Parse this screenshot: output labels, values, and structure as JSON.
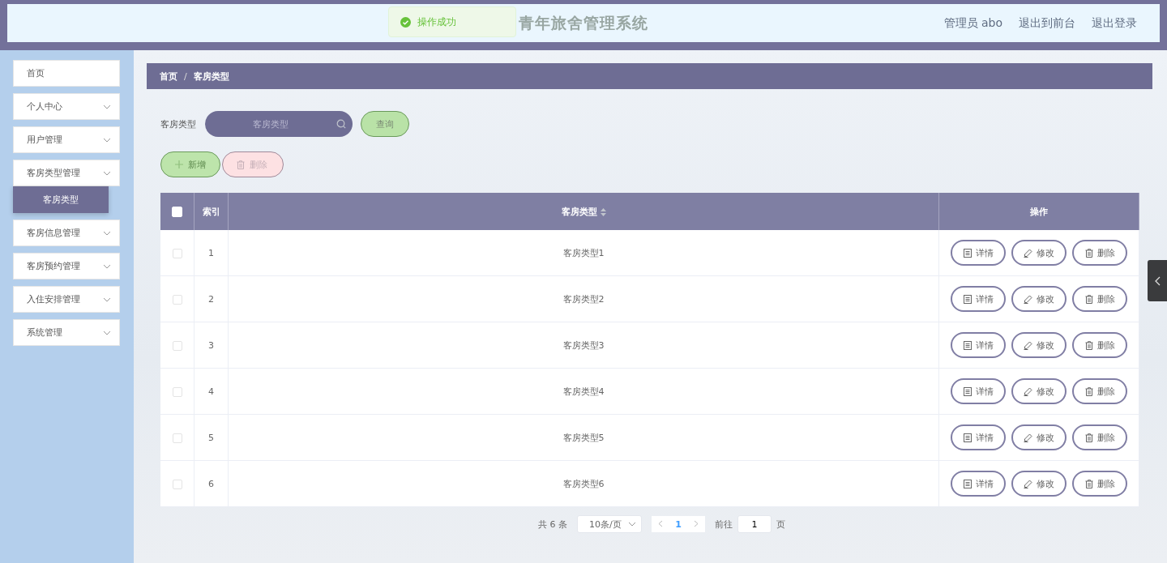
{
  "header": {
    "title": "青年旅舍管理系统",
    "toast": {
      "text": "操作成功",
      "kind": "success"
    },
    "links": [
      "管理员 abo",
      "退出到前台",
      "退出登录"
    ]
  },
  "sidebar": {
    "items": [
      {
        "label": "首页",
        "kind": "link"
      },
      {
        "label": "个人中心",
        "kind": "menu"
      },
      {
        "label": "用户管理",
        "kind": "menu"
      },
      {
        "label": "客房类型管理",
        "kind": "menu",
        "children": [
          {
            "label": "客房类型",
            "selected": true
          }
        ]
      },
      {
        "label": "客房信息管理",
        "kind": "menu"
      },
      {
        "label": "客房预约管理",
        "kind": "menu"
      },
      {
        "label": "入住安排管理",
        "kind": "menu"
      },
      {
        "label": "系统管理",
        "kind": "menu"
      }
    ]
  },
  "breadcrumb": {
    "items": [
      "首页",
      "客房类型"
    ],
    "separator": "/"
  },
  "search": {
    "label": "客房类型",
    "placeholder": "客房类型",
    "button": "查询"
  },
  "actions": [
    {
      "label": "新增",
      "kind": "add"
    },
    {
      "label": "删除",
      "kind": "delete"
    }
  ],
  "table": {
    "select_all": {
      "checked": false
    },
    "columns": [
      {
        "label": "索引",
        "kind": "plain"
      },
      {
        "label": "客房类型",
        "kind": "sortable"
      },
      {
        "label": "操作",
        "kind": "plain"
      }
    ],
    "rows": [
      {
        "checked": false,
        "index": "1",
        "type": "客房类型1",
        "actions": [
          {
            "label": "详情",
            "kind": "detail"
          },
          {
            "label": "修改",
            "kind": "edit"
          },
          {
            "label": "删除",
            "kind": "delete"
          }
        ]
      },
      {
        "checked": false,
        "index": "2",
        "type": "客房类型2",
        "actions": [
          {
            "label": "详情",
            "kind": "detail"
          },
          {
            "label": "修改",
            "kind": "edit"
          },
          {
            "label": "删除",
            "kind": "delete"
          }
        ]
      },
      {
        "checked": false,
        "index": "3",
        "type": "客房类型3",
        "actions": [
          {
            "label": "详情",
            "kind": "detail"
          },
          {
            "label": "修改",
            "kind": "edit"
          },
          {
            "label": "删除",
            "kind": "delete"
          }
        ]
      },
      {
        "checked": false,
        "index": "4",
        "type": "客房类型4",
        "actions": [
          {
            "label": "详情",
            "kind": "detail"
          },
          {
            "label": "修改",
            "kind": "edit"
          },
          {
            "label": "删除",
            "kind": "delete"
          }
        ]
      },
      {
        "checked": false,
        "index": "5",
        "type": "客房类型5",
        "actions": [
          {
            "label": "详情",
            "kind": "detail"
          },
          {
            "label": "修改",
            "kind": "edit"
          },
          {
            "label": "删除",
            "kind": "delete"
          }
        ]
      },
      {
        "checked": false,
        "index": "6",
        "type": "客房类型6",
        "actions": [
          {
            "label": "详情",
            "kind": "detail"
          },
          {
            "label": "修改",
            "kind": "edit"
          },
          {
            "label": "删除",
            "kind": "delete"
          }
        ]
      }
    ]
  },
  "pagination": {
    "total": "共 6 条",
    "page_size": "10条/页",
    "pages": [
      {
        "label": "1",
        "selected": true
      }
    ],
    "goto_label": "前往",
    "goto_value": "1",
    "goto_suffix": "页"
  }
}
